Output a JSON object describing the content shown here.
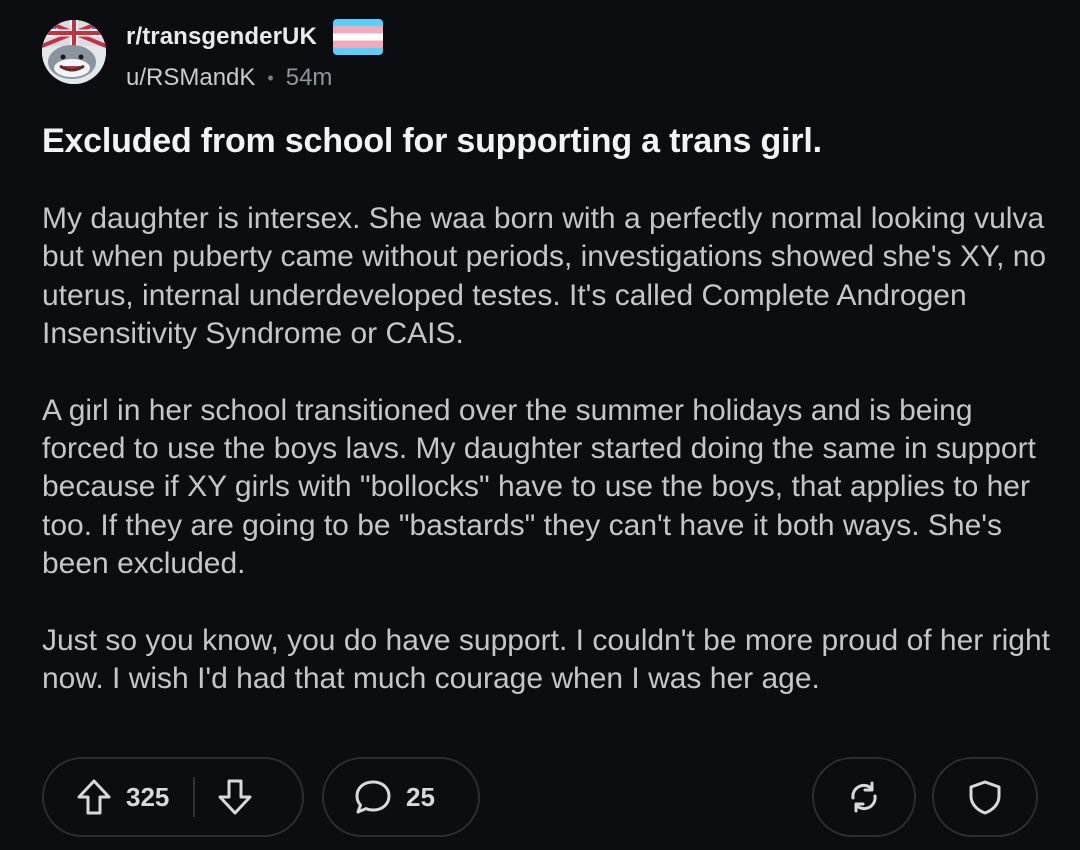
{
  "header": {
    "subreddit": "r/transgenderUK",
    "username": "u/RSMandK",
    "separator": "•",
    "time": "54m"
  },
  "post": {
    "title": "Excluded from school for supporting a trans girl.",
    "paragraphs": [
      "My daughter is intersex. She waa born with a perfectly normal looking vulva but when puberty came without periods, investigations showed she's XY, no uterus, internal underdeveloped testes. It's called Complete Androgen Insensitivity Syndrome or CAIS.",
      "A girl in her school transitioned over the summer holidays and is being forced to use the boys lavs. My daughter started doing the same in support because if XY girls with \"bollocks\" have to use the boys, that applies to her too. If they are going to be \"bastards\" they can't have it both ways. She's been excluded.",
      "Just so you know, you do have support. I couldn't be more proud of her right now. I wish I'd had that much courage when I was her age."
    ]
  },
  "actions": {
    "upvotes": "325",
    "comments": "25"
  },
  "colors": {
    "background": "#0b0d10",
    "text": "#c3c7cb",
    "flag_blue": "#5bcefa",
    "flag_pink": "#f5a9b8",
    "flag_white": "#ffffff"
  },
  "icons": [
    "avatar",
    "trans-flag-icon",
    "upvote-icon",
    "downvote-icon",
    "comment-icon",
    "share-icon",
    "award-icon"
  ]
}
